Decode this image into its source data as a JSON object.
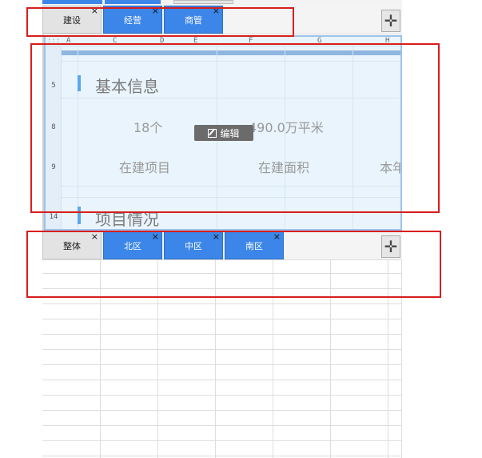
{
  "tabbar_top": {
    "tabs": [
      {
        "label": "建设",
        "style": "grey",
        "close": "×"
      },
      {
        "label": "经营",
        "style": "blue",
        "close": "×"
      },
      {
        "label": "商管",
        "style": "blue",
        "close": "×"
      }
    ],
    "add_icon": "plus-cross-icon"
  },
  "sheet": {
    "columns": [
      "A",
      "C",
      "D",
      "E",
      "F",
      "G",
      "H"
    ],
    "rows": [
      "5",
      "8",
      "9",
      "14"
    ],
    "section1_title": "基本信息",
    "stat1_value": "18个",
    "stat2_value": "490.0万平米",
    "stat1_label": "在建项目",
    "stat2_label": "在建面积",
    "stat3_label_partial": "本年",
    "section2_title": "项目情况",
    "edit_button": "编辑"
  },
  "tabbar_bottom": {
    "tabs": [
      {
        "label": "整体",
        "style": "grey",
        "close": "×"
      },
      {
        "label": "北区",
        "style": "blue",
        "close": "×"
      },
      {
        "label": "中区",
        "style": "blue",
        "close": "×"
      },
      {
        "label": "南区",
        "style": "blue",
        "close": "×"
      }
    ],
    "add_icon": "plus-cross-icon"
  },
  "colors": {
    "tab_blue": "#3b86e8",
    "selection_bg": "#e9f4fc",
    "annotation_red": "#d81e1e"
  }
}
